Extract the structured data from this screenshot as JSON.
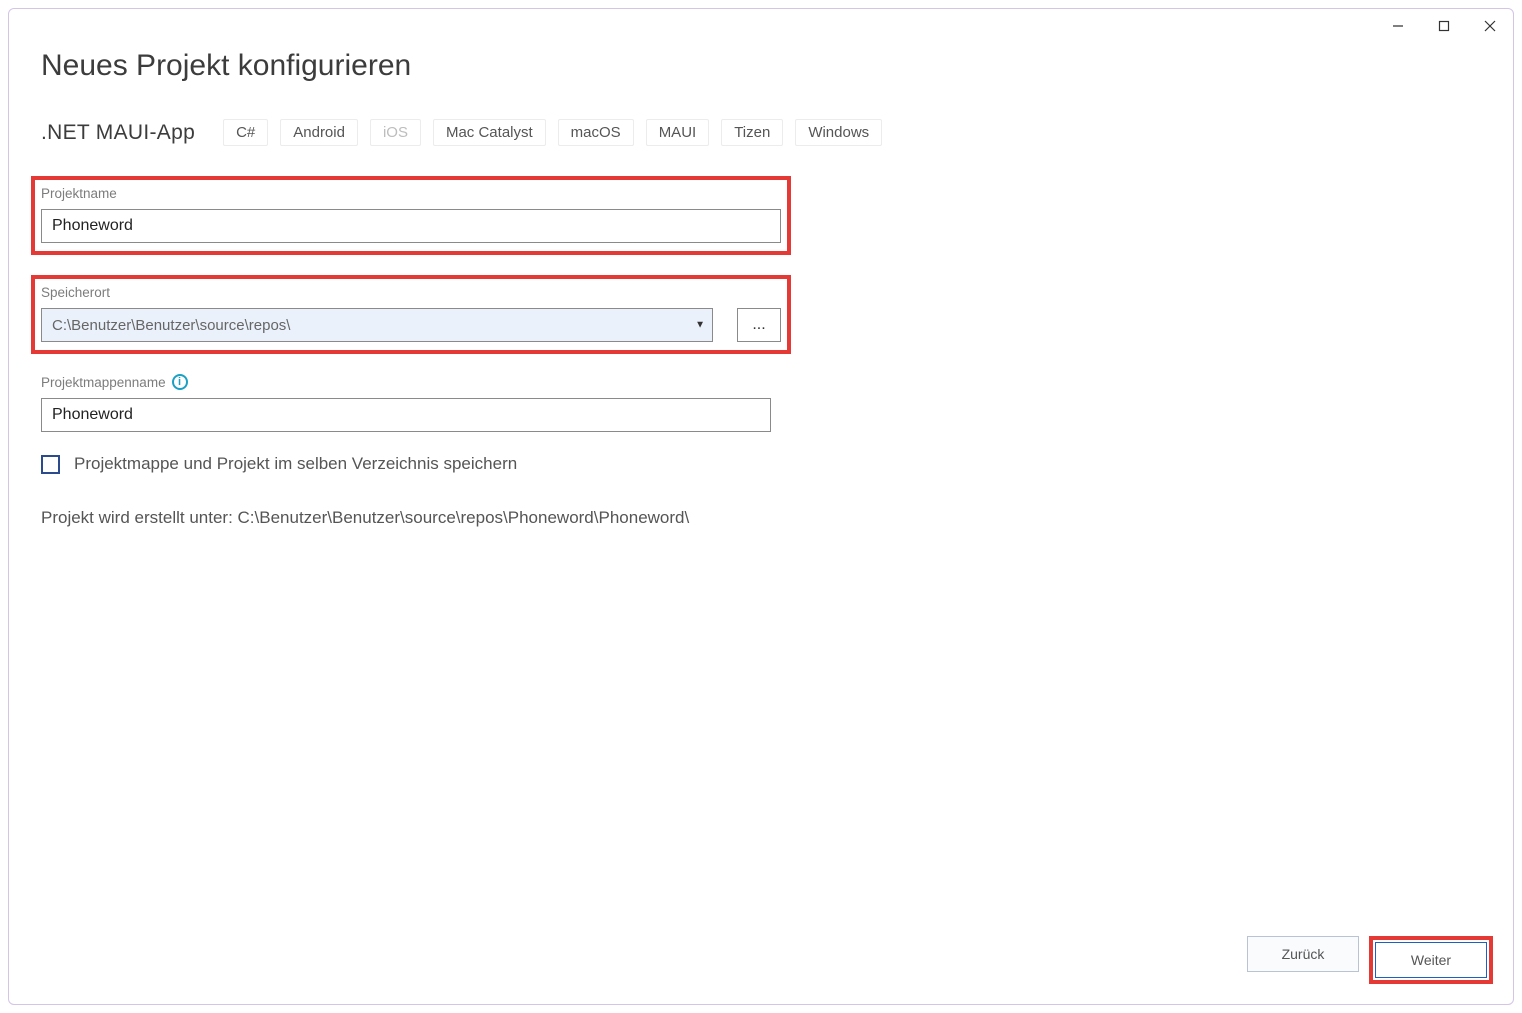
{
  "window": {
    "title": "Neues Projekt konfigurieren",
    "subtitle": ".NET MAUI-App",
    "tags": [
      "C#",
      "Android",
      "iOS",
      "Mac Catalyst",
      "macOS",
      "MAUI",
      "Tizen",
      "Windows"
    ]
  },
  "fields": {
    "project_name": {
      "label": "Projektname",
      "value": "Phoneword"
    },
    "location": {
      "label": "Speicherort",
      "value": "C:\\Benutzer\\Benutzer\\source\\repos\\",
      "browse": "..."
    },
    "solution_name": {
      "label": "Projektmappenname",
      "value": "Phoneword"
    }
  },
  "checkbox": {
    "same_dir_label": "Projektmappe und Projekt im selben Verzeichnis speichern",
    "checked": false
  },
  "creation_path": "Projekt wird erstellt unter: C:\\Benutzer\\Benutzer\\source\\repos\\Phoneword\\Phoneword\\",
  "buttons": {
    "back": "Zurück",
    "next": "Weiter"
  }
}
